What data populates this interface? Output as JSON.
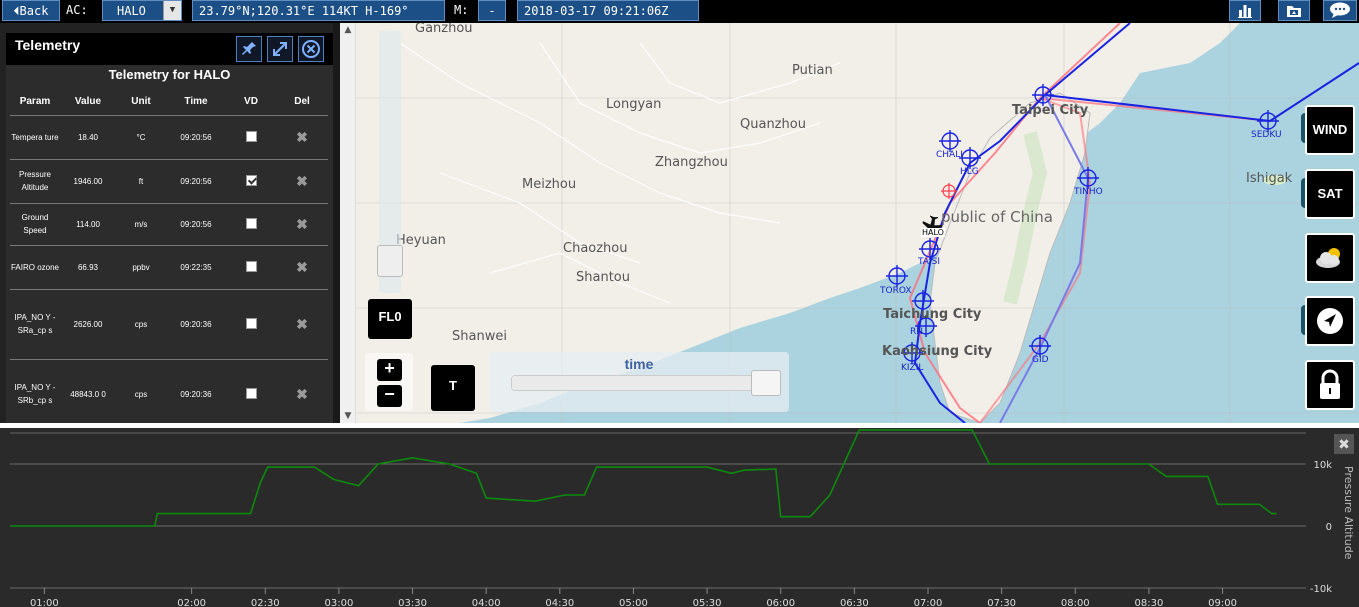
{
  "topbar": {
    "back_label": "⏴Back",
    "ac_label": "AC:",
    "ac_selected": "HALO",
    "position": "23.79°N;120.31°E 114KT H-169°",
    "m_label": "M:",
    "m_value": "-",
    "time": "2018-03-17 09:21:06Z",
    "icons": [
      "bar-chart-icon",
      "folder-icon",
      "chat-bubble-icon"
    ]
  },
  "telemetry": {
    "title": "Telemetry",
    "subtitle": "Telemetry for HALO",
    "header_icons": [
      "pin-icon",
      "expand-icon",
      "close-circle-icon"
    ],
    "columns": [
      "Param",
      "Value",
      "Unit",
      "Time",
      "VD",
      "Del"
    ],
    "rows": [
      {
        "param": "Tempera ture",
        "value": "18.40",
        "unit": "°C",
        "time": "09:20:56",
        "vd": false
      },
      {
        "param": "Pressure Altitude",
        "value": "1946.00",
        "unit": "ft",
        "time": "09:20:56",
        "vd": true
      },
      {
        "param": "Ground Speed",
        "value": "114.00",
        "unit": "m/s",
        "time": "09:20:56",
        "vd": false
      },
      {
        "param": "FAIRO ozone",
        "value": "66.93",
        "unit": "ppbv",
        "time": "09:22:35",
        "vd": false
      },
      {
        "param": "IPA_NO Y - SRa_cp s",
        "value": "2626.00",
        "unit": "cps",
        "time": "09:20:36",
        "vd": false
      },
      {
        "param": "IPA_NO Y - SRb_cp s",
        "value": "48843.0 0",
        "unit": "cps",
        "time": "09:20:36",
        "vd": false
      }
    ],
    "delete_glyph": "✖"
  },
  "map": {
    "places": [
      {
        "name": "Ganzhou",
        "kind": "city"
      },
      {
        "name": "Putian",
        "kind": "city"
      },
      {
        "name": "Longyan",
        "kind": "city"
      },
      {
        "name": "Quanzhou",
        "kind": "city"
      },
      {
        "name": "Zhangzhou",
        "kind": "city"
      },
      {
        "name": "Meizhou",
        "kind": "city"
      },
      {
        "name": "Heyuan",
        "kind": "city"
      },
      {
        "name": "Chaozhou",
        "kind": "city"
      },
      {
        "name": "Shantou",
        "kind": "city"
      },
      {
        "name": "Shanwei",
        "kind": "city"
      },
      {
        "name": "Taipei City",
        "kind": "city"
      },
      {
        "name": "public of China",
        "kind": "country"
      },
      {
        "name": "Taichung City",
        "kind": "city"
      },
      {
        "name": "Kaohsiung City",
        "kind": "city"
      },
      {
        "name": "Ishigak",
        "kind": "city"
      }
    ],
    "waypoints": [
      "SEDKU",
      "CHALI",
      "HLG",
      "TINHO",
      "TAISI",
      "TOROX",
      "RN",
      "KIZIL",
      "GID"
    ],
    "aircraft_label": "HALO",
    "fl_button": "FL0",
    "zoom_in": "+",
    "zoom_out": "−",
    "t_button": "T",
    "time_label": "time",
    "time_slider_value": 0.95,
    "side_buttons": {
      "wind": "WIND",
      "sat": "SAT",
      "icons": [
        "weather-cloud-icon",
        "navigation-arrow-icon",
        "lock-icon"
      ]
    }
  },
  "plot": {
    "y_label": "Pressure Altitude",
    "close_glyph": "✖"
  },
  "chart_data": {
    "type": "line",
    "title": "",
    "ylabel": "Pressure Altitude",
    "xlabel": "",
    "x_ticks": [
      "01:00",
      "02:00",
      "02:30",
      "03:00",
      "03:30",
      "04:00",
      "04:30",
      "05:00",
      "05:30",
      "06:00",
      "06:30",
      "07:00",
      "07:30",
      "08:00",
      "08:30",
      "09:00"
    ],
    "y_ticks": [
      "10k",
      "0",
      "-10k"
    ],
    "ylim": [
      -10000,
      15000
    ],
    "grid": true,
    "series": [
      {
        "color": "#0c8a0c",
        "points": [
          [
            "00:46",
            0
          ],
          [
            "01:45",
            0
          ],
          [
            "01:46",
            2000
          ],
          [
            "02:24",
            2000
          ],
          [
            "02:28",
            7000
          ],
          [
            "02:31",
            9500
          ],
          [
            "02:40",
            9500
          ],
          [
            "02:50",
            9500
          ],
          [
            "02:58",
            7500
          ],
          [
            "03:08",
            6500
          ],
          [
            "03:16",
            10000
          ],
          [
            "03:30",
            11000
          ],
          [
            "03:45",
            10000
          ],
          [
            "03:56",
            8500
          ],
          [
            "04:00",
            4500
          ],
          [
            "04:20",
            4000
          ],
          [
            "04:32",
            5000
          ],
          [
            "04:40",
            5000
          ],
          [
            "04:45",
            9500
          ],
          [
            "05:00",
            9500
          ],
          [
            "05:30",
            9500
          ],
          [
            "05:40",
            8500
          ],
          [
            "05:45",
            9000
          ],
          [
            "05:58",
            9200
          ],
          [
            "06:00",
            1500
          ],
          [
            "06:12",
            1500
          ],
          [
            "06:20",
            5000
          ],
          [
            "06:32",
            15500
          ],
          [
            "06:50",
            15500
          ],
          [
            "07:18",
            15500
          ],
          [
            "07:25",
            10000
          ],
          [
            "07:45",
            10000
          ],
          [
            "08:30",
            10000
          ],
          [
            "08:37",
            8000
          ],
          [
            "08:54",
            8000
          ],
          [
            "08:58",
            3500
          ],
          [
            "09:15",
            3500
          ],
          [
            "09:20",
            2000
          ],
          [
            "09:22",
            2000
          ]
        ]
      }
    ]
  }
}
